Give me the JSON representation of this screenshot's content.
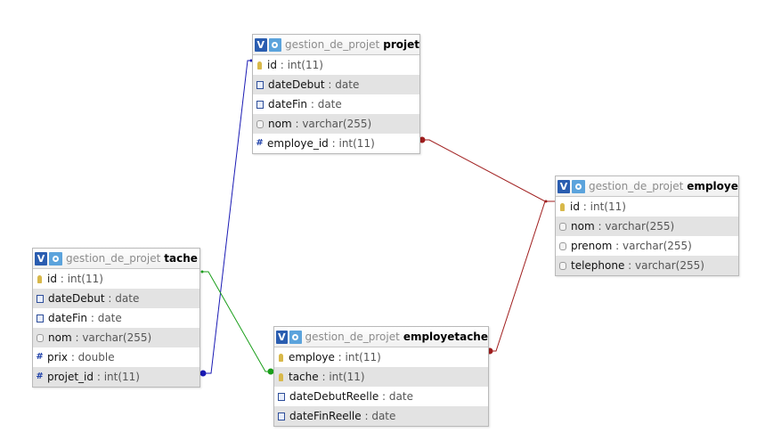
{
  "colors": {
    "link_projet_tache": "#1a1ab4",
    "link_tache_employetache": "#1a9e1a",
    "link_employe": "#a01e1e",
    "row_alt_background": "#e3e3e3",
    "header_v_button": "#2a5db0",
    "header_gear_button": "#5ba3dc"
  },
  "tables": {
    "projet": {
      "database": "gestion_de_projet",
      "name": "projet",
      "view_button_label": "V",
      "fields": [
        {
          "name": "id",
          "type": "int(11)",
          "icon": "primary-key-icon"
        },
        {
          "name": "dateDebut",
          "type": "date",
          "icon": "date-icon"
        },
        {
          "name": "dateFin",
          "type": "date",
          "icon": "date-icon"
        },
        {
          "name": "nom",
          "type": "varchar(255)",
          "icon": "text-icon"
        },
        {
          "name": "employe_id",
          "type": "int(11)",
          "icon": "number-icon"
        }
      ]
    },
    "employe": {
      "database": "gestion_de_projet",
      "name": "employe",
      "view_button_label": "V",
      "fields": [
        {
          "name": "id",
          "type": "int(11)",
          "icon": "primary-key-icon"
        },
        {
          "name": "nom",
          "type": "varchar(255)",
          "icon": "text-icon"
        },
        {
          "name": "prenom",
          "type": "varchar(255)",
          "icon": "text-icon"
        },
        {
          "name": "telephone",
          "type": "varchar(255)",
          "icon": "text-icon"
        }
      ]
    },
    "tache": {
      "database": "gestion_de_projet",
      "name": "tache",
      "view_button_label": "V",
      "fields": [
        {
          "name": "id",
          "type": "int(11)",
          "icon": "primary-key-icon"
        },
        {
          "name": "dateDebut",
          "type": "date",
          "icon": "date-icon"
        },
        {
          "name": "dateFin",
          "type": "date",
          "icon": "date-icon"
        },
        {
          "name": "nom",
          "type": "varchar(255)",
          "icon": "text-icon"
        },
        {
          "name": "prix",
          "type": "double",
          "icon": "number-icon"
        },
        {
          "name": "projet_id",
          "type": "int(11)",
          "icon": "number-icon"
        }
      ]
    },
    "employetache": {
      "database": "gestion_de_projet",
      "name": "employetache",
      "view_button_label": "V",
      "fields": [
        {
          "name": "employe",
          "type": "int(11)",
          "icon": "primary-key-icon"
        },
        {
          "name": "tache",
          "type": "int(11)",
          "icon": "primary-key-icon"
        },
        {
          "name": "dateDebutReelle",
          "type": "date",
          "icon": "date-icon"
        },
        {
          "name": "dateFinReelle",
          "type": "date",
          "icon": "date-icon"
        }
      ]
    }
  }
}
